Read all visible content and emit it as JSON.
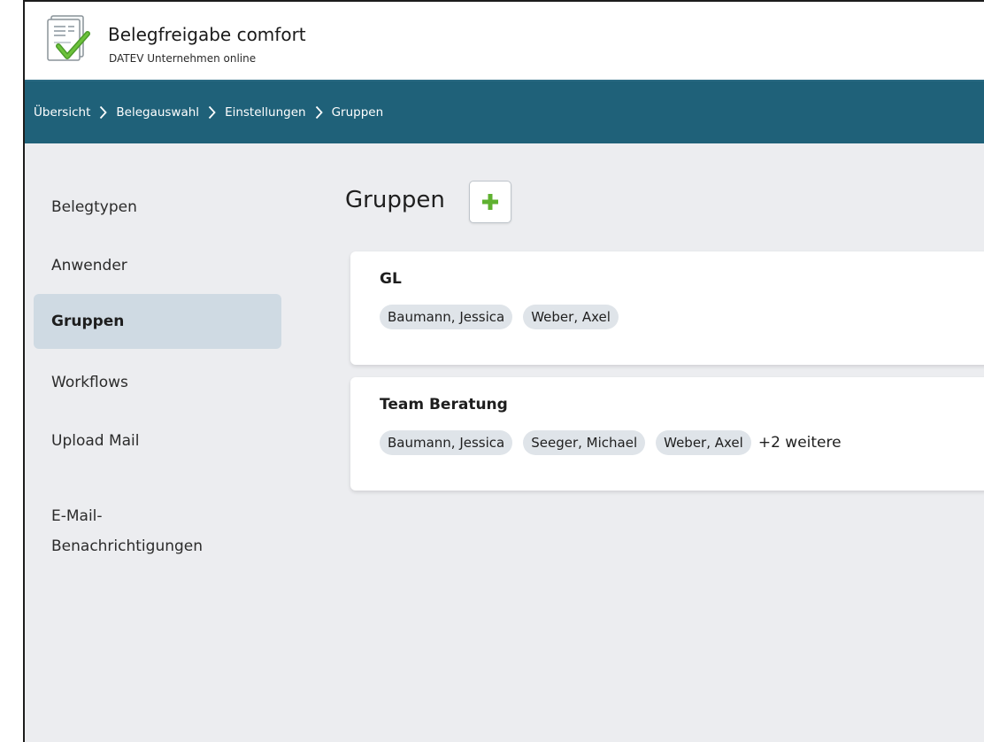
{
  "header": {
    "app_title": "Belegfreigabe comfort",
    "app_subtitle": "DATEV Unternehmen online",
    "logo_icon": "document-check-icon"
  },
  "breadcrumb": {
    "items": [
      "Übersicht",
      "Belegauswahl",
      "Einstellungen",
      "Gruppen"
    ],
    "separator_icon": "chevron-right-icon"
  },
  "sidebar": {
    "items": [
      {
        "label": "Belegtypen",
        "active": false
      },
      {
        "label": "Anwender",
        "active": false
      },
      {
        "label": "Gruppen",
        "active": true
      },
      {
        "label": "Workflows",
        "active": false
      },
      {
        "label": "Upload Mail",
        "active": false
      },
      {
        "label": "E-Mail-\nBenachrichtigungen",
        "active": false
      }
    ]
  },
  "main": {
    "title": "Gruppen",
    "add_button_icon": "plus-icon",
    "groups": [
      {
        "name": "GL",
        "members": [
          "Baumann, Jessica",
          "Weber, Axel"
        ],
        "more": ""
      },
      {
        "name": "Team Beratung",
        "members": [
          "Baumann, Jessica",
          "Seeger, Michael",
          "Weber, Axel"
        ],
        "more": "+2 weitere"
      }
    ]
  },
  "colors": {
    "breadcrumb_bar": "#1f6179",
    "background": "#ecedf0",
    "sidebar_active": "#cfdae3",
    "chip": "#dfe4e9",
    "plus_green": "#5fb130"
  }
}
